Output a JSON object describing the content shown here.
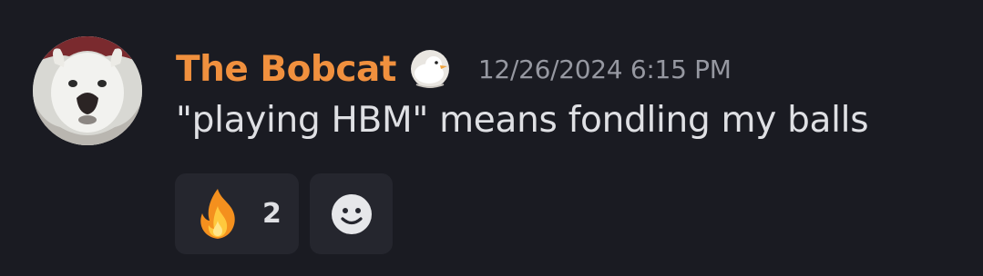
{
  "message": {
    "username": "The Bobcat",
    "timestamp": "12/26/2024 6:15 PM",
    "content": "\"playing HBM\" means fondling my balls",
    "badge_icon": "duck-badge-icon",
    "username_color": "#f0903e"
  },
  "reactions": [
    {
      "emoji": "fire-emoji-icon",
      "count": "2"
    }
  ],
  "add_reaction": {
    "icon": "smiley-add-reaction-icon"
  }
}
